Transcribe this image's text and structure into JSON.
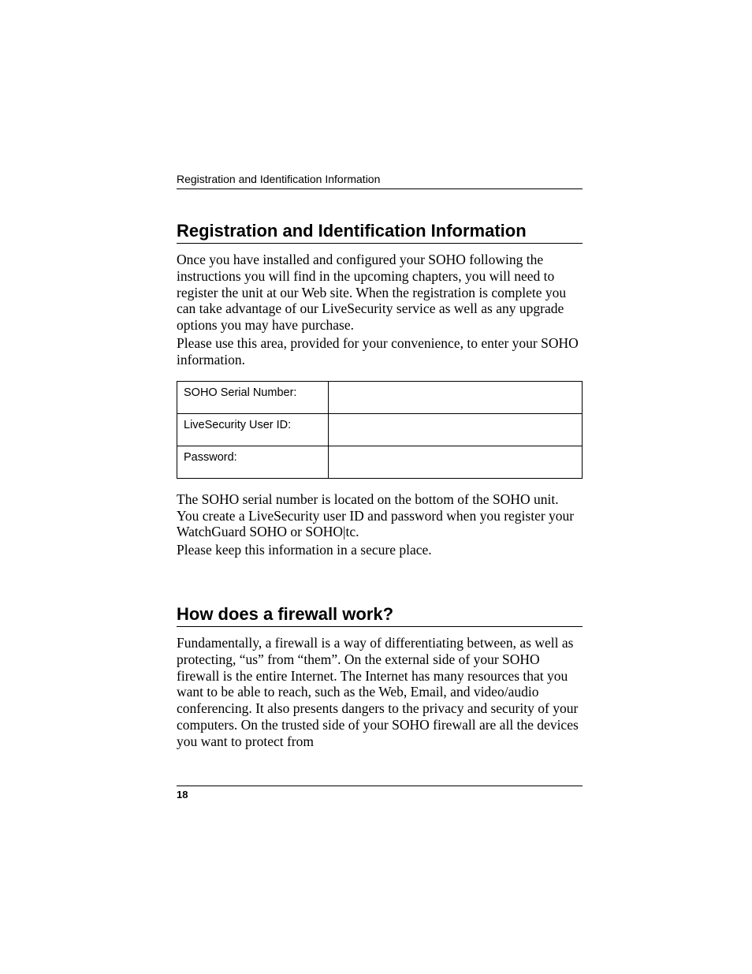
{
  "header": {
    "running": "Registration and Identification Information"
  },
  "section1": {
    "heading": "Registration and Identification Information",
    "para1": "Once you have installed and configured your SOHO following the instructions you will find in the upcoming chapters, you will need to register the unit at our Web site.  When the registration is complete you can take advantage of our LiveSecurity service as well as any upgrade options you may have purchase.",
    "para2": "Please use this area, provided for your convenience, to enter your SOHO information.",
    "table": {
      "rows": [
        {
          "label": "SOHO Serial Number:",
          "value": ""
        },
        {
          "label": "LiveSecurity User ID:",
          "value": ""
        },
        {
          "label": "Password:",
          "value": ""
        }
      ]
    },
    "para3": "The SOHO serial number is located on the bottom of the SOHO unit. You create a LiveSecurity user ID and password when you register your WatchGuard SOHO or SOHO|tc.",
    "para4": "Please keep this information in a secure place."
  },
  "section2": {
    "heading": "How does a firewall work?",
    "para1": "Fundamentally, a firewall is a way of differentiating between, as well as protecting, “us” from “them”. On the external side of your SOHO firewall is the entire Internet. The Internet has many resources that you want to be able to reach, such as the Web, Email, and video/audio conferencing. It also presents dangers to the privacy and security of your computers. On the trusted side of your SOHO firewall are all the devices you want to protect from"
  },
  "footer": {
    "page_number": "18"
  }
}
